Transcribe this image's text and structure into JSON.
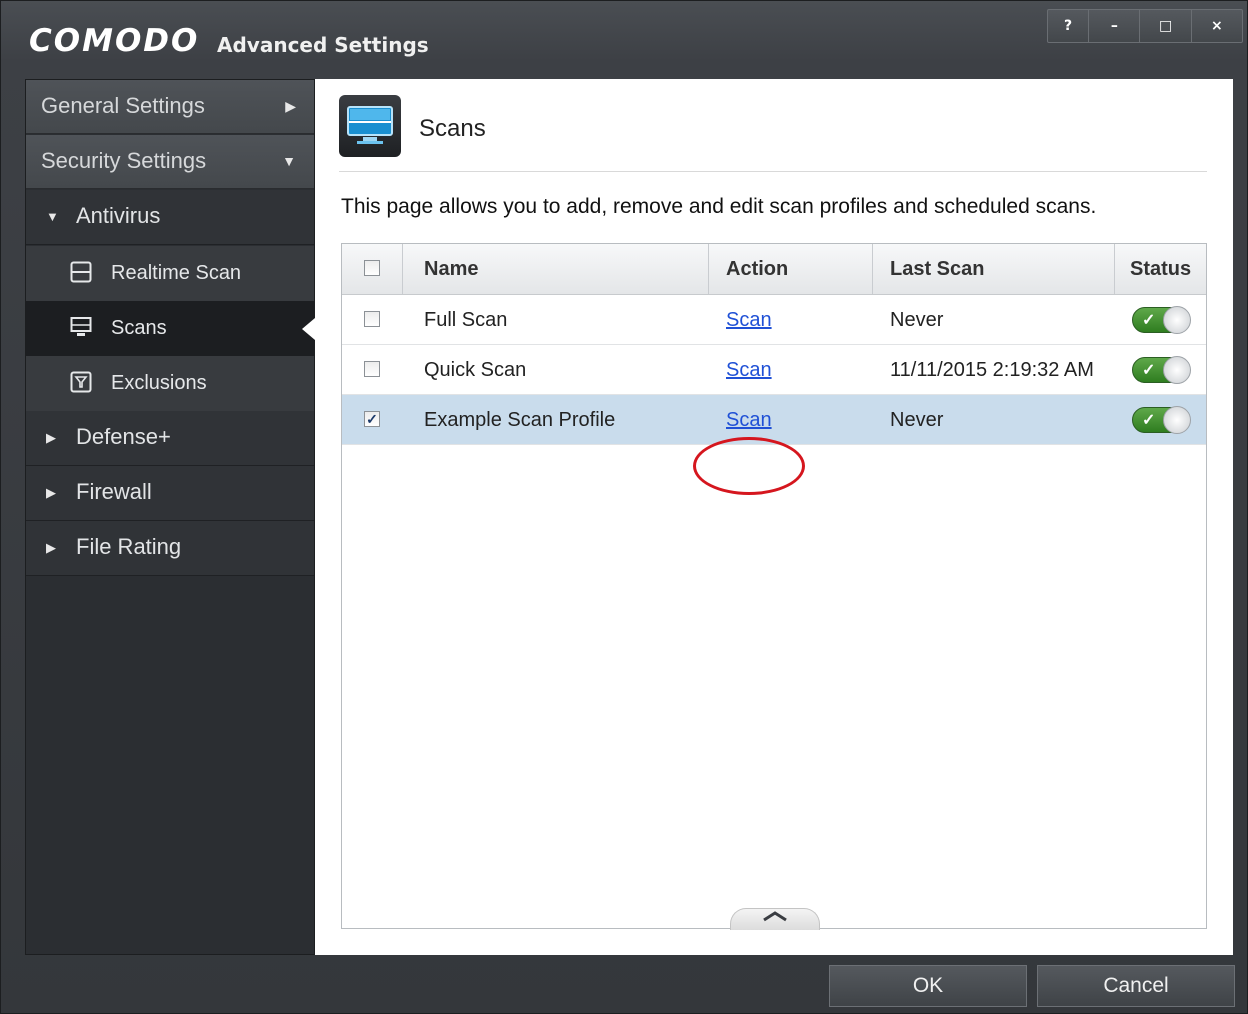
{
  "window": {
    "brand": "COMODO",
    "title": "Advanced Settings",
    "controls": [
      "?",
      "–",
      "□",
      "×"
    ]
  },
  "sidebar": {
    "general_settings": "General Settings",
    "security_settings": "Security Settings",
    "sections": [
      {
        "label": "Antivirus",
        "expanded": true
      },
      {
        "label": "Defense+",
        "expanded": false
      },
      {
        "label": "Firewall",
        "expanded": false
      },
      {
        "label": "File Rating",
        "expanded": false
      }
    ],
    "antivirus_items": [
      {
        "label": "Realtime Scan",
        "icon": "realtime-scan-icon"
      },
      {
        "label": "Scans",
        "icon": "monitor-icon",
        "active": true
      },
      {
        "label": "Exclusions",
        "icon": "filter-icon"
      }
    ]
  },
  "main": {
    "page_title": "Scans",
    "description": "This page allows you to add, remove and edit scan profiles and scheduled scans.",
    "table": {
      "columns": [
        "Name",
        "Action",
        "Last Scan",
        "Status"
      ],
      "rows": [
        {
          "name": "Full Scan",
          "action": "Scan",
          "last_scan": "Never",
          "checked": false,
          "enabled": true
        },
        {
          "name": "Quick Scan",
          "action": "Scan",
          "last_scan": "11/11/2015 2:19:32 AM",
          "checked": false,
          "enabled": true
        },
        {
          "name": "Example Scan Profile",
          "action": "Scan",
          "last_scan": "Never",
          "checked": true,
          "enabled": true
        }
      ]
    }
  },
  "footer": {
    "ok_label": "OK",
    "cancel_label": "Cancel"
  },
  "colors": {
    "toggle_on": "#3f8f2f",
    "selected_row": "#c9dcec",
    "link": "#1f50d6",
    "highlight_circle": "#d5161e"
  }
}
